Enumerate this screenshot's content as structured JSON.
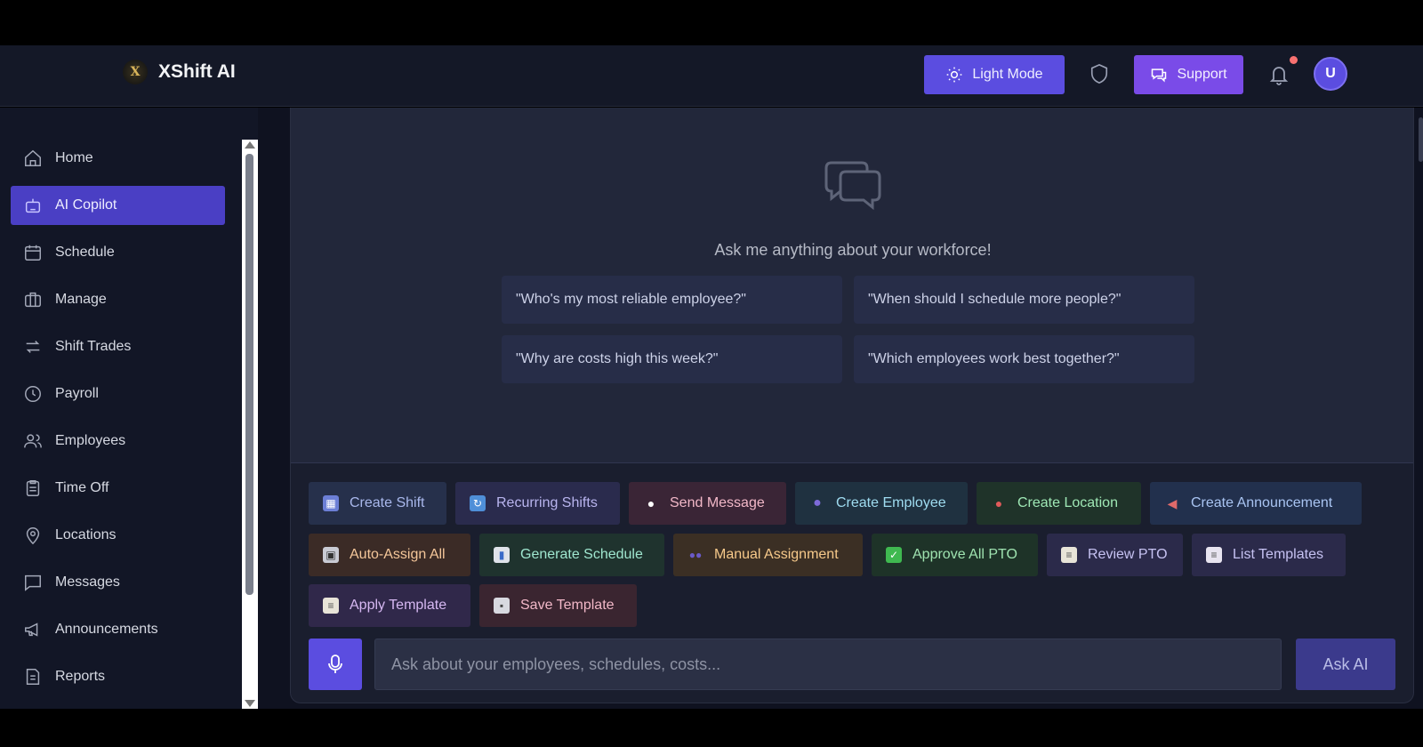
{
  "app": {
    "name": "XShift AI",
    "logo_text": "X"
  },
  "header": {
    "light_mode_label": "Light Mode",
    "support_label": "Support",
    "avatar_initial": "U",
    "notification_dot_color": "#f87171"
  },
  "sidebar": {
    "items": [
      {
        "label": "Home",
        "icon": "home-icon",
        "active": false
      },
      {
        "label": "AI Copilot",
        "icon": "robot-icon",
        "active": true
      },
      {
        "label": "Schedule",
        "icon": "calendar-icon",
        "active": false
      },
      {
        "label": "Manage",
        "icon": "briefcase-icon",
        "active": false
      },
      {
        "label": "Shift Trades",
        "icon": "swap-icon",
        "active": false
      },
      {
        "label": "Payroll",
        "icon": "clock-icon",
        "active": false
      },
      {
        "label": "Employees",
        "icon": "users-icon",
        "active": false
      },
      {
        "label": "Time Off",
        "icon": "clipboard-icon",
        "active": false
      },
      {
        "label": "Locations",
        "icon": "map-pin-icon",
        "active": false
      },
      {
        "label": "Messages",
        "icon": "message-icon",
        "active": false
      },
      {
        "label": "Announcements",
        "icon": "megaphone-icon",
        "active": false
      },
      {
        "label": "Reports",
        "icon": "file-icon",
        "active": false
      }
    ]
  },
  "copilot": {
    "empty_title": "Ask me anything about your workforce!",
    "suggestions": [
      "\"Who's my most reliable employee?\"",
      "\"When should I schedule more people?\"",
      "\"Why are costs high this week?\"",
      "\"Which employees work best together?\""
    ],
    "actions": [
      {
        "label": "Create Shift",
        "icon": "calendar-emoji-icon"
      },
      {
        "label": "Recurring Shifts",
        "icon": "repeat-emoji-icon"
      },
      {
        "label": "Send Message",
        "icon": "speech-bubble-emoji-icon"
      },
      {
        "label": "Create Employee",
        "icon": "person-emoji-icon"
      },
      {
        "label": "Create Location",
        "icon": "pin-emoji-icon"
      },
      {
        "label": "Create Announcement",
        "icon": "megaphone-emoji-icon"
      },
      {
        "label": "Auto-Assign All",
        "icon": "robot-emoji-icon"
      },
      {
        "label": "Generate Schedule",
        "icon": "chart-emoji-icon"
      },
      {
        "label": "Manual Assignment",
        "icon": "people-emoji-icon"
      },
      {
        "label": "Approve All PTO",
        "icon": "checkbox-emoji-icon"
      },
      {
        "label": "Review PTO",
        "icon": "clipboard-emoji-icon"
      },
      {
        "label": "List Templates",
        "icon": "page-emoji-icon"
      },
      {
        "label": "Apply Template",
        "icon": "clipboard-emoji-icon"
      },
      {
        "label": "Save Template",
        "icon": "floppy-emoji-icon"
      }
    ],
    "input_placeholder": "Ask about your employees, schedules, costs...",
    "ask_button_label": "Ask AI"
  },
  "colors": {
    "accent": "#5b4de0",
    "support": "#7a4be8",
    "sidebar_active": "#4a3fc4"
  }
}
